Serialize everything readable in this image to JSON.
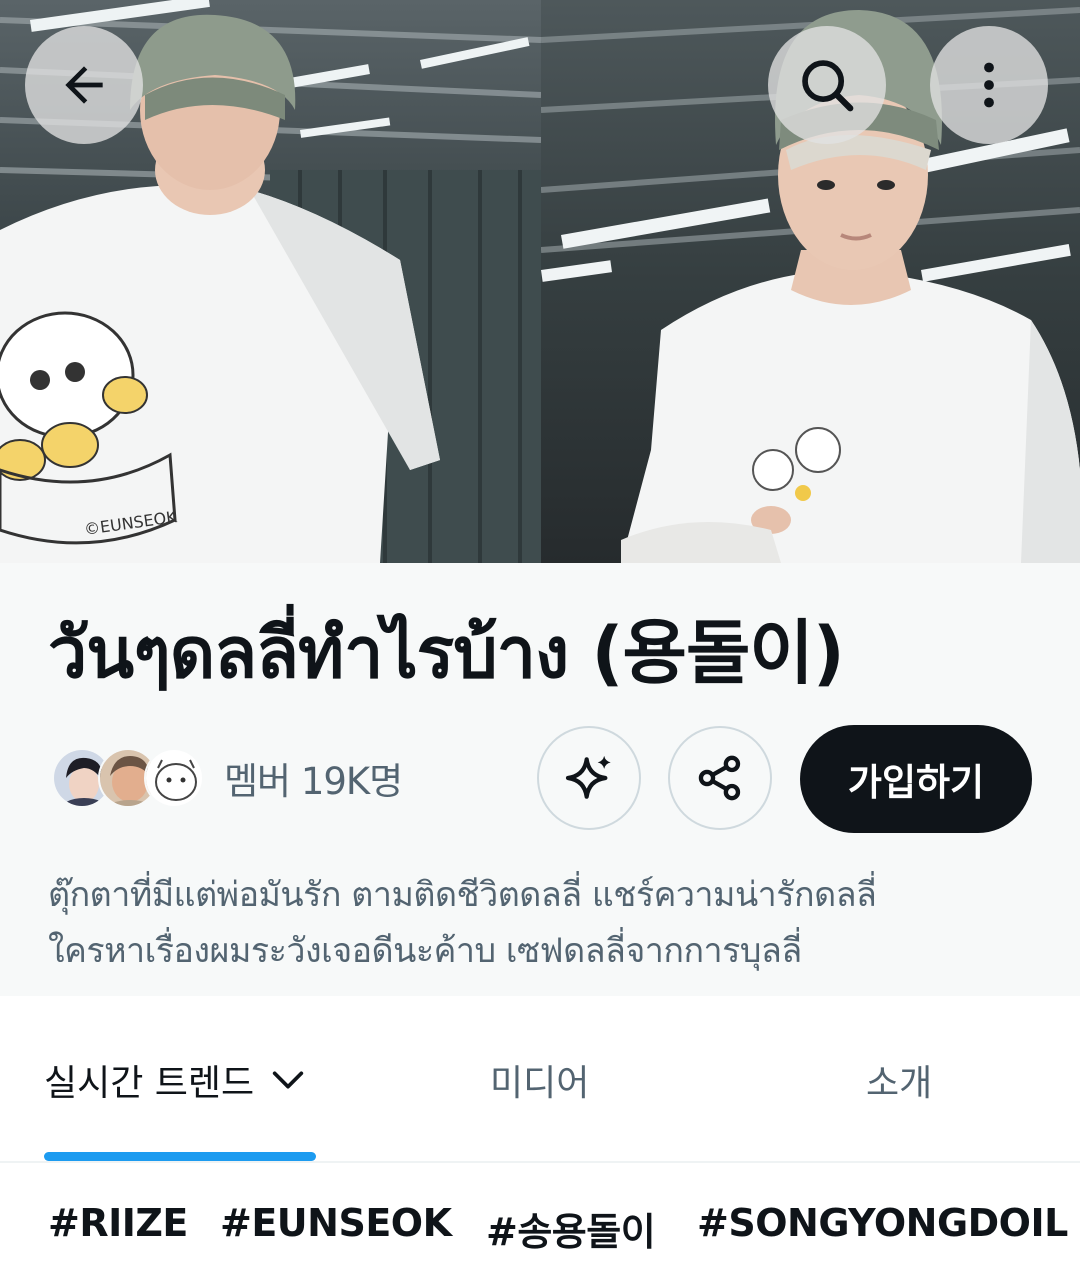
{
  "header": {
    "back_icon": "arrow-left-icon",
    "search_icon": "search-icon",
    "more_icon": "more-vertical-icon"
  },
  "community": {
    "title": "วันๆดลลี่ทำไรบ้าง (용돌이)",
    "members_label": "멤버 19K명",
    "join_label": "가입하기",
    "sparkle_icon": "sparkle-icon",
    "share_icon": "share-icon",
    "description": [
      "ตุ๊กตาที่มีแต่พ่อมันรัก ตามติดชีวิตดลลี่ แชร์ความน่ารักดลลี่",
      "ใครหาเรื่องผมระวังเจอดีนะค้าบ เซฟดลลี่จากการบุลลี่"
    ]
  },
  "tabs": [
    {
      "label": "실시간 트렌드",
      "active": true
    },
    {
      "label": "미디어",
      "active": false
    },
    {
      "label": "소개",
      "active": false
    }
  ],
  "hashtags": [
    "#RIIZE",
    "#EUNSEOK",
    "#송용돌이",
    "#SONGYONGDOIL"
  ],
  "colors": {
    "accent": "#1d9bf0",
    "text_primary": "#0f1419",
    "text_secondary": "#536471",
    "header_bg": "#f7f9f9"
  }
}
